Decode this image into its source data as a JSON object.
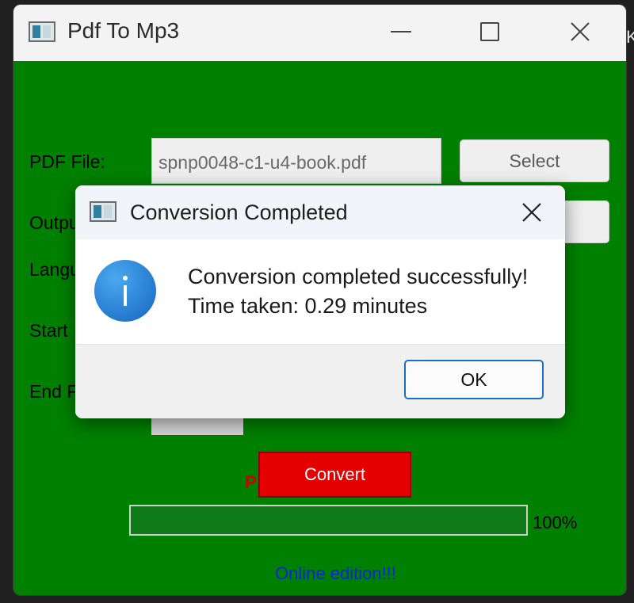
{
  "window": {
    "title": "Pdf To Mp3",
    "background_color": "#008000"
  },
  "form": {
    "pdf_label": "PDF File:",
    "pdf_value": "spnp0048-c1-u4-book.pdf",
    "select_label": "Select",
    "output_label": "Outpu",
    "language_label": "Langu",
    "start_label": "Start",
    "end_label": "End F",
    "processing_text": "P",
    "convert_label": "Convert",
    "progress_value": 1.0,
    "progress_text": "100%",
    "footer_text": "Online edition!!!"
  },
  "dialog": {
    "title": "Conversion Completed",
    "message_line1": "Conversion completed successfully!",
    "message_line2": "Time taken: 0.29 minutes",
    "ok_label": "OK",
    "icon": "info-icon"
  },
  "background": {
    "edge_text": "K"
  },
  "colors": {
    "convert_button": "#e40000",
    "footer_text": "#0a25d8",
    "ok_border": "#1b6ec2",
    "info_icon": "#1e88e5"
  }
}
